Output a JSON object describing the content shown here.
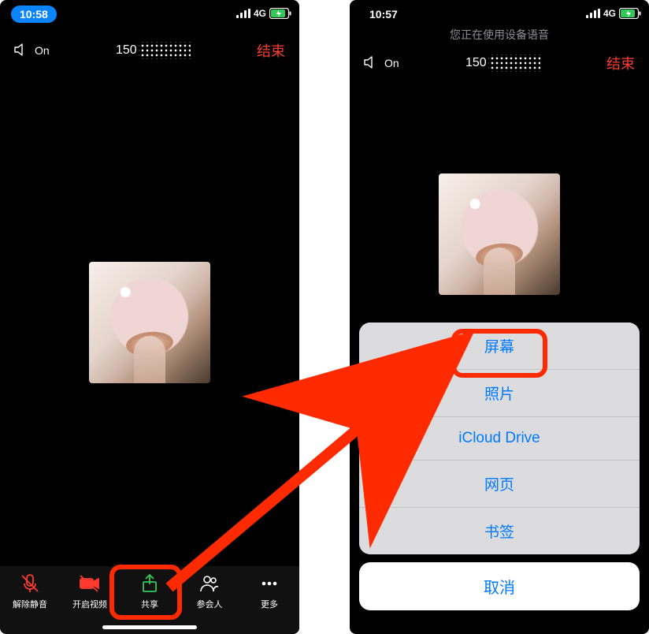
{
  "left": {
    "status": {
      "time": "10:58",
      "net_label": "4G"
    },
    "call": {
      "speaker_label": "On",
      "number_prefix": "150",
      "end_label": "结束"
    },
    "tabs": {
      "unmute": "解除静音",
      "video": "开启视频",
      "share": "共享",
      "participants": "参会人",
      "more": "更多"
    }
  },
  "right": {
    "status": {
      "time": "10:57",
      "net_label": "4G"
    },
    "subtitle": "您正在使用设备语音",
    "call": {
      "speaker_label": "On",
      "number_prefix": "150",
      "end_label": "结束"
    },
    "sheet": {
      "items": [
        "屏幕",
        "照片",
        "iCloud Drive",
        "网页",
        "书签"
      ],
      "cancel": "取消"
    }
  }
}
